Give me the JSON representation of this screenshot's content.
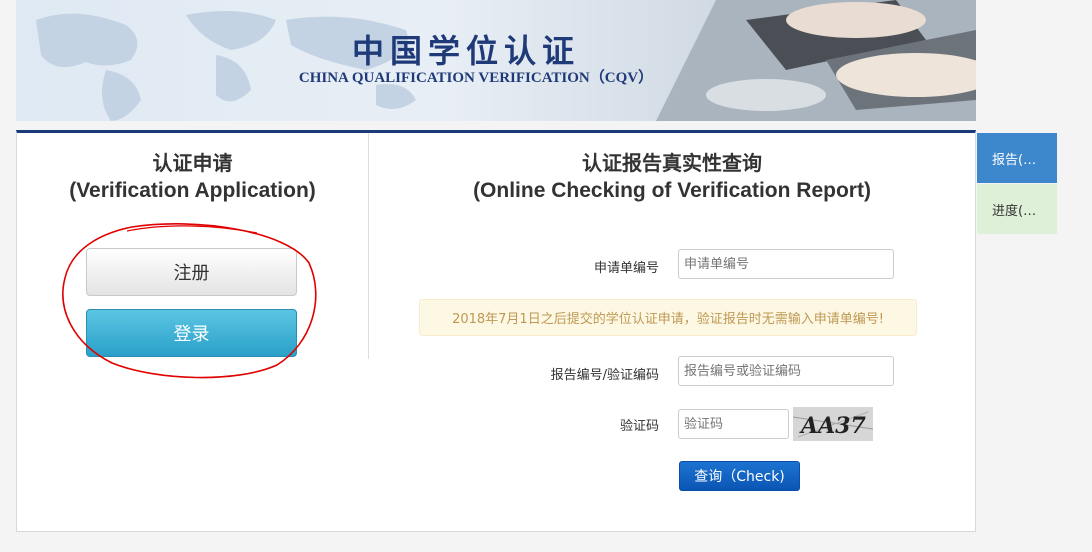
{
  "banner": {
    "title_cn": "中国学位认证",
    "title_en": "CHINA QUALIFICATION VERIFICATION（CQV）"
  },
  "application": {
    "heading_cn": "认证申请",
    "heading_en": "(Verification Application)",
    "register_label": "注册",
    "login_label": "登录"
  },
  "report_check": {
    "heading_cn": "认证报告真实性查询",
    "heading_en": "(Online Checking of Verification Report)",
    "app_no_label": "申请单编号",
    "app_no_placeholder": "申请单编号",
    "notice": "2018年7月1日之后提交的学位认证申请，验证报告时无需输入申请单编号!",
    "report_no_label": "报告编号/验证编码",
    "report_no_placeholder": "报告编号或验证编码",
    "captcha_label": "验证码",
    "captcha_placeholder": "验证码",
    "captcha_text": "AA37",
    "check_button": "查询（Check)"
  },
  "side_tabs": {
    "report": "报告(…",
    "progress": "进度(…"
  },
  "colors": {
    "brand_navy": "#1a3b7a",
    "login_blue": "#2aa0c9",
    "check_blue": "#0b55b4",
    "notice_text": "#c09853",
    "annotation_red": "#e00000"
  }
}
